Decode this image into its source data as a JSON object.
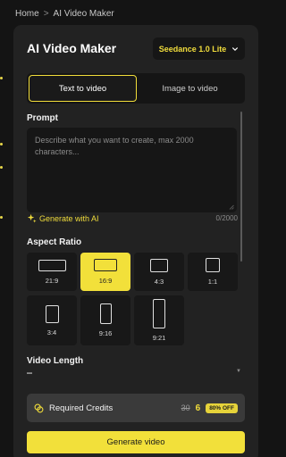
{
  "breadcrumb": {
    "home": "Home",
    "separator": ">",
    "current": "AI Video Maker"
  },
  "panel": {
    "title": "AI Video Maker"
  },
  "model_select": {
    "value": "Seedance 1.0 Lite",
    "icon": "chevron-down-icon"
  },
  "tabs": [
    {
      "label": "Text to video",
      "active": true
    },
    {
      "label": "Image to video",
      "active": false
    }
  ],
  "prompt": {
    "label": "Prompt",
    "placeholder": "Describe what you want to create, max 2000 characters...",
    "counter": "0/2000",
    "generate_ai_label": "Generate with AI",
    "generate_ai_icon": "sparkle-icon"
  },
  "aspect_ratio": {
    "label": "Aspect Ratio",
    "selected": "16:9",
    "options": [
      {
        "label": "21:9"
      },
      {
        "label": "16:9"
      },
      {
        "label": "4:3"
      },
      {
        "label": "1:1"
      },
      {
        "label": "3:4"
      },
      {
        "label": "9:16"
      },
      {
        "label": "9:21"
      }
    ]
  },
  "video_length": {
    "label": "Video Length"
  },
  "credits": {
    "label": "Required Credits",
    "original": "30",
    "current": "6",
    "discount": "80% OFF",
    "icon": "coins-icon"
  },
  "generate_button": {
    "label": "Generate video"
  },
  "colors": {
    "accent": "#f2e03a",
    "panel": "#222222",
    "background": "#141414"
  }
}
